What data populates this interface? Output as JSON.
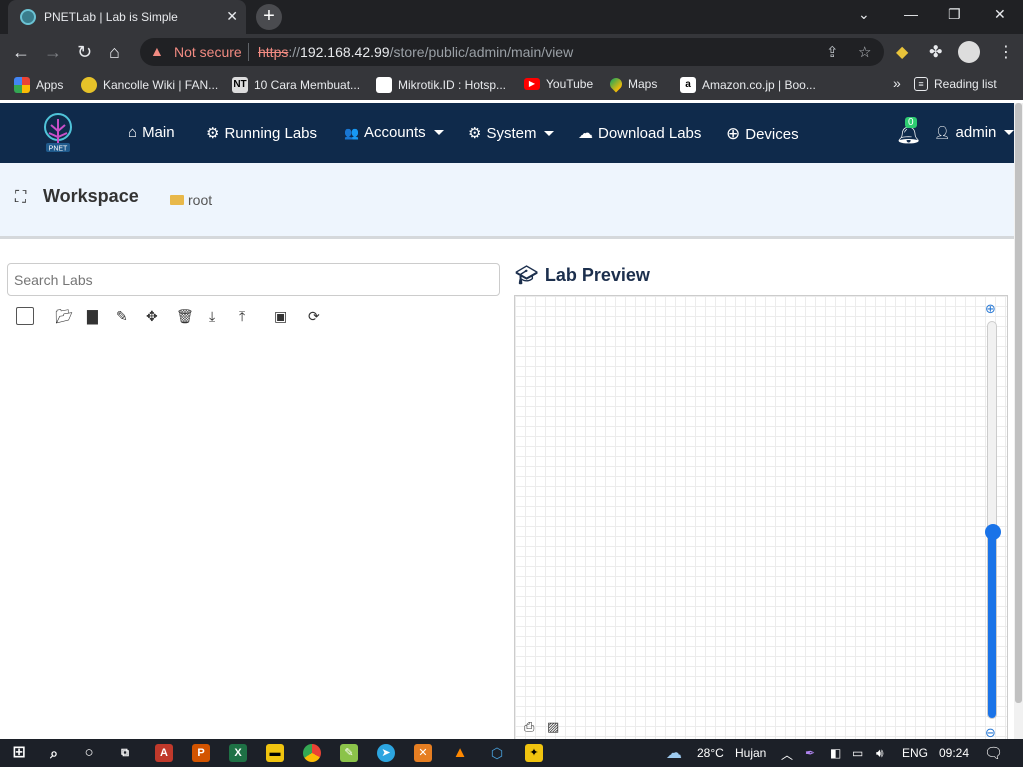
{
  "browser": {
    "tab_title": "PNETLab | Lab is Simple",
    "tab_close": "✕",
    "new_tab": "+",
    "not_secure": "Not secure",
    "url_scheme": "https",
    "url_sep": "://",
    "url_host": "192.168.42.99",
    "url_path": "/store/public/admin/main/view",
    "window_controls": {
      "minimize": "—",
      "restore": "❐",
      "close": "✕",
      "dropdown": "⌄"
    }
  },
  "bookmarks": [
    {
      "label": "Apps",
      "icon": "apps-grid-icon"
    },
    {
      "label": "Kancolle Wiki | FAN...",
      "icon": "kancolle-icon"
    },
    {
      "label": "10 Cara Membuat...",
      "icon": "nt-icon",
      "badge": "NT"
    },
    {
      "label": "Mikrotik.ID : Hotsp...",
      "icon": "mikrotik-icon"
    },
    {
      "label": "YouTube",
      "icon": "youtube-icon"
    },
    {
      "label": "Maps",
      "icon": "maps-icon"
    },
    {
      "label": "Amazon.co.jp | Boo...",
      "icon": "amazon-icon",
      "badge": "a"
    }
  ],
  "bookmarks_more": "»",
  "reading_list": "Reading list",
  "navbar": {
    "items": [
      {
        "label": "Main",
        "icon": "home-icon",
        "glyph": "⌂",
        "dropdown": false
      },
      {
        "label": "Running Labs",
        "icon": "cogs-icon",
        "glyph": "⚙",
        "dropdown": false
      },
      {
        "label": "Accounts",
        "icon": "users-icon",
        "glyph": "👥",
        "dropdown": true
      },
      {
        "label": "System",
        "icon": "gear-icon",
        "glyph": "⚙",
        "dropdown": true
      },
      {
        "label": "Download Labs",
        "icon": "cloud-download-icon",
        "glyph": "☁",
        "dropdown": false
      },
      {
        "label": "Devices",
        "icon": "plus-circle-icon",
        "glyph": "⊕",
        "dropdown": false
      }
    ],
    "notifications_count": "0",
    "user": "admin"
  },
  "workspace": {
    "title": "Workspace",
    "folder": "root"
  },
  "search": {
    "placeholder": "Search Labs"
  },
  "toolbar_icons": [
    "open-folder-icon",
    "new-file-icon",
    "edit-pencil-icon",
    "move-arrows-icon",
    "trash-icon",
    "import-download-icon",
    "export-upload-icon",
    "select-dropdown-icon",
    "refresh-icon"
  ],
  "lab_preview": {
    "title": "Lab Preview",
    "zoom_level": 0.47
  },
  "taskbar": {
    "temperature": "28°C",
    "weather": "Hujan",
    "language": "ENG",
    "time": "09:24"
  }
}
